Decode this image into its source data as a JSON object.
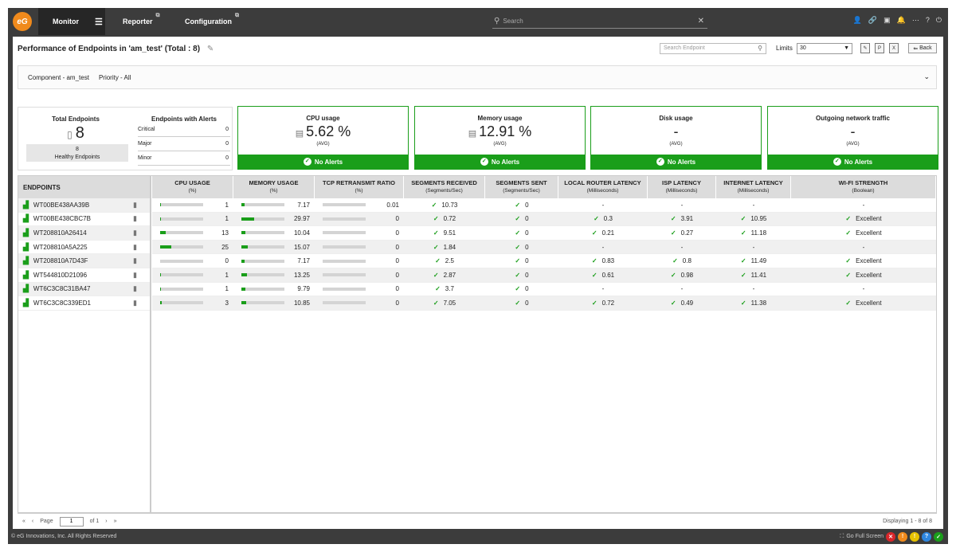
{
  "topbar": {
    "logo": "eG",
    "nav": [
      "Monitor",
      "Reporter",
      "Configuration"
    ],
    "search_placeholder": "Search"
  },
  "page": {
    "title": "Performance of Endpoints in 'am_test' (Total : 8)",
    "search_endpoint_placeholder": "Search Endpoint",
    "limits_label": "Limits",
    "limits_value": "30",
    "back_label": "Back"
  },
  "filters": {
    "component": "Component - am_test",
    "priority": "Priority - All"
  },
  "summary": {
    "total_title": "Total Endpoints",
    "total_value": "8",
    "healthy_value": "8",
    "healthy_label": "Healthy Endpoints",
    "alerts_title": "Endpoints with Alerts",
    "alerts": [
      {
        "label": "Critical",
        "value": "0"
      },
      {
        "label": "Major",
        "value": "0"
      },
      {
        "label": "Minor",
        "value": "0"
      }
    ]
  },
  "metrics": [
    {
      "title": "CPU usage",
      "value": "5.62 %",
      "avg": "(AVG)",
      "status": "No Alerts"
    },
    {
      "title": "Memory usage",
      "value": "12.91 %",
      "avg": "(AVG)",
      "status": "No Alerts"
    },
    {
      "title": "Disk usage",
      "value": "-",
      "avg": "(AVG)",
      "status": "No Alerts"
    },
    {
      "title": "Outgoing network traffic",
      "value": "-",
      "avg": "(AVG)",
      "status": "No Alerts"
    }
  ],
  "grid": {
    "endpoints_header": "ENDPOINTS",
    "columns": [
      {
        "name": "CPU USAGE",
        "unit": "(%)"
      },
      {
        "name": "MEMORY USAGE",
        "unit": "(%)"
      },
      {
        "name": "TCP RETRANSMIT RATIO",
        "unit": "(%)"
      },
      {
        "name": "SEGMENTS RECEIVED",
        "unit": "(Segments/Sec)"
      },
      {
        "name": "SEGMENTS SENT",
        "unit": "(Segments/Sec)"
      },
      {
        "name": "LOCAL ROUTER LATENCY",
        "unit": "(Milliseconds)"
      },
      {
        "name": "ISP LATENCY",
        "unit": "(Milliseconds)"
      },
      {
        "name": "INTERNET LATENCY",
        "unit": "(Milliseconds)"
      },
      {
        "name": "WI-FI STRENGTH",
        "unit": "(Boolean)"
      }
    ],
    "rows": [
      {
        "name": "WT00BE438AA39B",
        "cpu": "1",
        "cpu_pct": 1,
        "mem": "7.17",
        "mem_pct": 7.17,
        "tcp": "0.01",
        "recv": "10.73",
        "sent": "0",
        "router": "-",
        "isp": "-",
        "inet": "-",
        "wifi": "-"
      },
      {
        "name": "WT00BE438CBC7B",
        "cpu": "1",
        "cpu_pct": 1,
        "mem": "29.97",
        "mem_pct": 29.97,
        "tcp": "0",
        "recv": "0.72",
        "sent": "0",
        "router": "0.3",
        "isp": "3.91",
        "inet": "10.95",
        "wifi": "Excellent"
      },
      {
        "name": "WT208810A26414",
        "cpu": "13",
        "cpu_pct": 13,
        "mem": "10.04",
        "mem_pct": 10.04,
        "tcp": "0",
        "recv": "9.51",
        "sent": "0",
        "router": "0.21",
        "isp": "0.27",
        "inet": "11.18",
        "wifi": "Excellent"
      },
      {
        "name": "WT208810A5A225",
        "cpu": "25",
        "cpu_pct": 25,
        "mem": "15.07",
        "mem_pct": 15.07,
        "tcp": "0",
        "recv": "1.84",
        "sent": "0",
        "router": "-",
        "isp": "-",
        "inet": "-",
        "wifi": "-"
      },
      {
        "name": "WT208810A7D43F",
        "cpu": "0",
        "cpu_pct": 0,
        "mem": "7.17",
        "mem_pct": 7.17,
        "tcp": "0",
        "recv": "2.5",
        "sent": "0",
        "router": "0.83",
        "isp": "0.8",
        "inet": "11.49",
        "wifi": "Excellent"
      },
      {
        "name": "WT544810D21096",
        "cpu": "1",
        "cpu_pct": 1,
        "mem": "13.25",
        "mem_pct": 13.25,
        "tcp": "0",
        "recv": "2.87",
        "sent": "0",
        "router": "0.61",
        "isp": "0.98",
        "inet": "11.41",
        "wifi": "Excellent"
      },
      {
        "name": "WT6C3C8C31BA47",
        "cpu": "1",
        "cpu_pct": 1,
        "mem": "9.79",
        "mem_pct": 9.79,
        "tcp": "0",
        "recv": "3.7",
        "sent": "0",
        "router": "-",
        "isp": "-",
        "inet": "-",
        "wifi": "-"
      },
      {
        "name": "WT6C3C8C339ED1",
        "cpu": "3",
        "cpu_pct": 3,
        "mem": "10.85",
        "mem_pct": 10.85,
        "tcp": "0",
        "recv": "7.05",
        "sent": "0",
        "router": "0.72",
        "isp": "0.49",
        "inet": "11.38",
        "wifi": "Excellent"
      }
    ]
  },
  "pager": {
    "page_label": "Page",
    "page_value": "1",
    "of_label": "of 1",
    "displaying": "Displaying 1 - 8 of 8"
  },
  "footer": {
    "copyright": "© eG Innovations, Inc. All Rights Reserved",
    "fullscreen": "Go Full Screen"
  },
  "colors": {
    "accent": "#1a9e1a",
    "logo": "#f08a1c"
  }
}
